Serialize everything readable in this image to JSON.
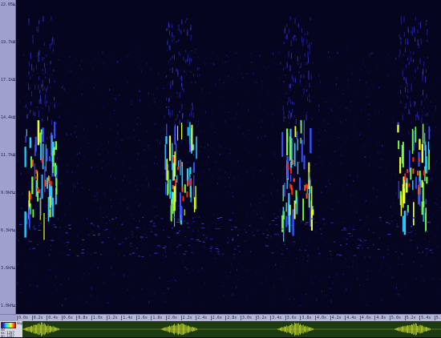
{
  "freq_axis": {
    "labels": [
      "22.05kHz",
      "19.7kHz",
      "17.1kHz",
      "14.4kHz",
      "11.7kHz",
      "9.0kHz",
      "6.3kHz",
      "3.6kHz",
      "1.0kHz"
    ]
  },
  "time_axis": {
    "labels": [
      "0.0s",
      "0.2s",
      "0.4s",
      "0.6s",
      "0.8s",
      "1.0s",
      "1.2s",
      "1.4s",
      "1.6s",
      "1.8s",
      "2.0s",
      "2.2s",
      "2.4s",
      "2.6s",
      "2.8s",
      "3.0s",
      "3.2s",
      "3.4s",
      "3.6s",
      "3.8s",
      "4.0s",
      "4.2s",
      "4.4s",
      "4.6s",
      "4.8s",
      "5.0s",
      "5.2s",
      "5.4s",
      "5.6s"
    ]
  },
  "waveform_panel": {
    "colorbar_label": "Amplitude",
    "readouts": [
      "dB",
      "mx:1207",
      "mn:1207"
    ]
  },
  "colors": {
    "background": "#05051f",
    "axis": "#9fa0cc",
    "wave_bg": "#1e3a10",
    "wave_line": "#d8e830"
  }
}
